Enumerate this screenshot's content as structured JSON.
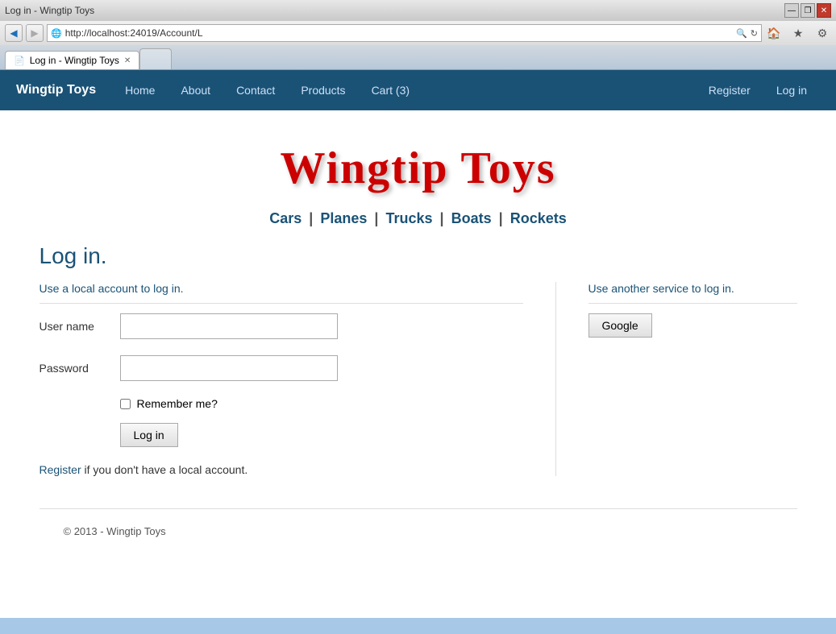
{
  "browser": {
    "url": "http://localhost:24019/Account/L",
    "tab_title": "Log in - Wingtip Toys",
    "back_btn": "◀",
    "forward_btn": "▶",
    "minimize": "—",
    "restore": "❐",
    "close": "✕"
  },
  "nav": {
    "brand": "Wingtip Toys",
    "links": [
      {
        "label": "Home",
        "name": "nav-home"
      },
      {
        "label": "About",
        "name": "nav-about"
      },
      {
        "label": "Contact",
        "name": "nav-contact"
      },
      {
        "label": "Products",
        "name": "nav-products"
      },
      {
        "label": "Cart (3)",
        "name": "nav-cart"
      }
    ],
    "right_links": [
      {
        "label": "Register",
        "name": "nav-register"
      },
      {
        "label": "Log in",
        "name": "nav-login"
      }
    ]
  },
  "hero": {
    "title": "Wingtip Toys"
  },
  "categories": {
    "items": [
      "Cars",
      "Planes",
      "Trucks",
      "Boats",
      "Rockets"
    ]
  },
  "login_page": {
    "heading": "Log in.",
    "local_section_heading": "Use a local account to log in.",
    "external_section_heading": "Use another service to log in.",
    "username_label": "User name",
    "password_label": "Password",
    "remember_me_label": "Remember me?",
    "login_btn_label": "Log in",
    "register_text": "Register",
    "register_suffix": " if you don't have a local account.",
    "google_btn_label": "Google"
  },
  "footer": {
    "text": "© 2013 - Wingtip Toys"
  }
}
